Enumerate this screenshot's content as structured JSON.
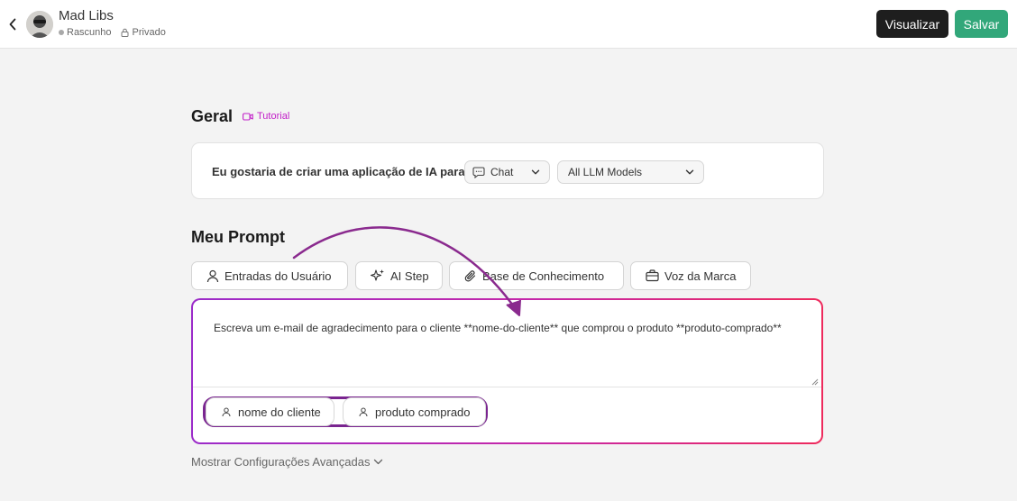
{
  "header": {
    "title": "Mad Libs",
    "status": "Rascunho",
    "visibility": "Privado",
    "preview_label": "Visualizar",
    "save_label": "Salvar",
    "save_color": "#32a77a"
  },
  "general": {
    "title": "Geral",
    "tutorial_label": "Tutorial",
    "create_label": "Eu gostaria de criar uma aplicação de IA para",
    "type_select": "Chat",
    "model_select": "All LLM Models"
  },
  "prompt": {
    "title": "Meu Prompt",
    "tools": [
      "Entradas do Usuário",
      "AI Step",
      "Base de Conhecimento",
      "Voz da Marca"
    ],
    "text": "Escreva um e-mail de agradecimento para o cliente **nome-do-cliente** que comprou o produto **produto-comprado**",
    "variables": [
      "nome do cliente",
      "produto comprado"
    ],
    "accent_gradient": [
      "#9b2bc9",
      "#ee2a5c"
    ]
  },
  "advanced_label": "Mostrar Configurações Avançadas"
}
